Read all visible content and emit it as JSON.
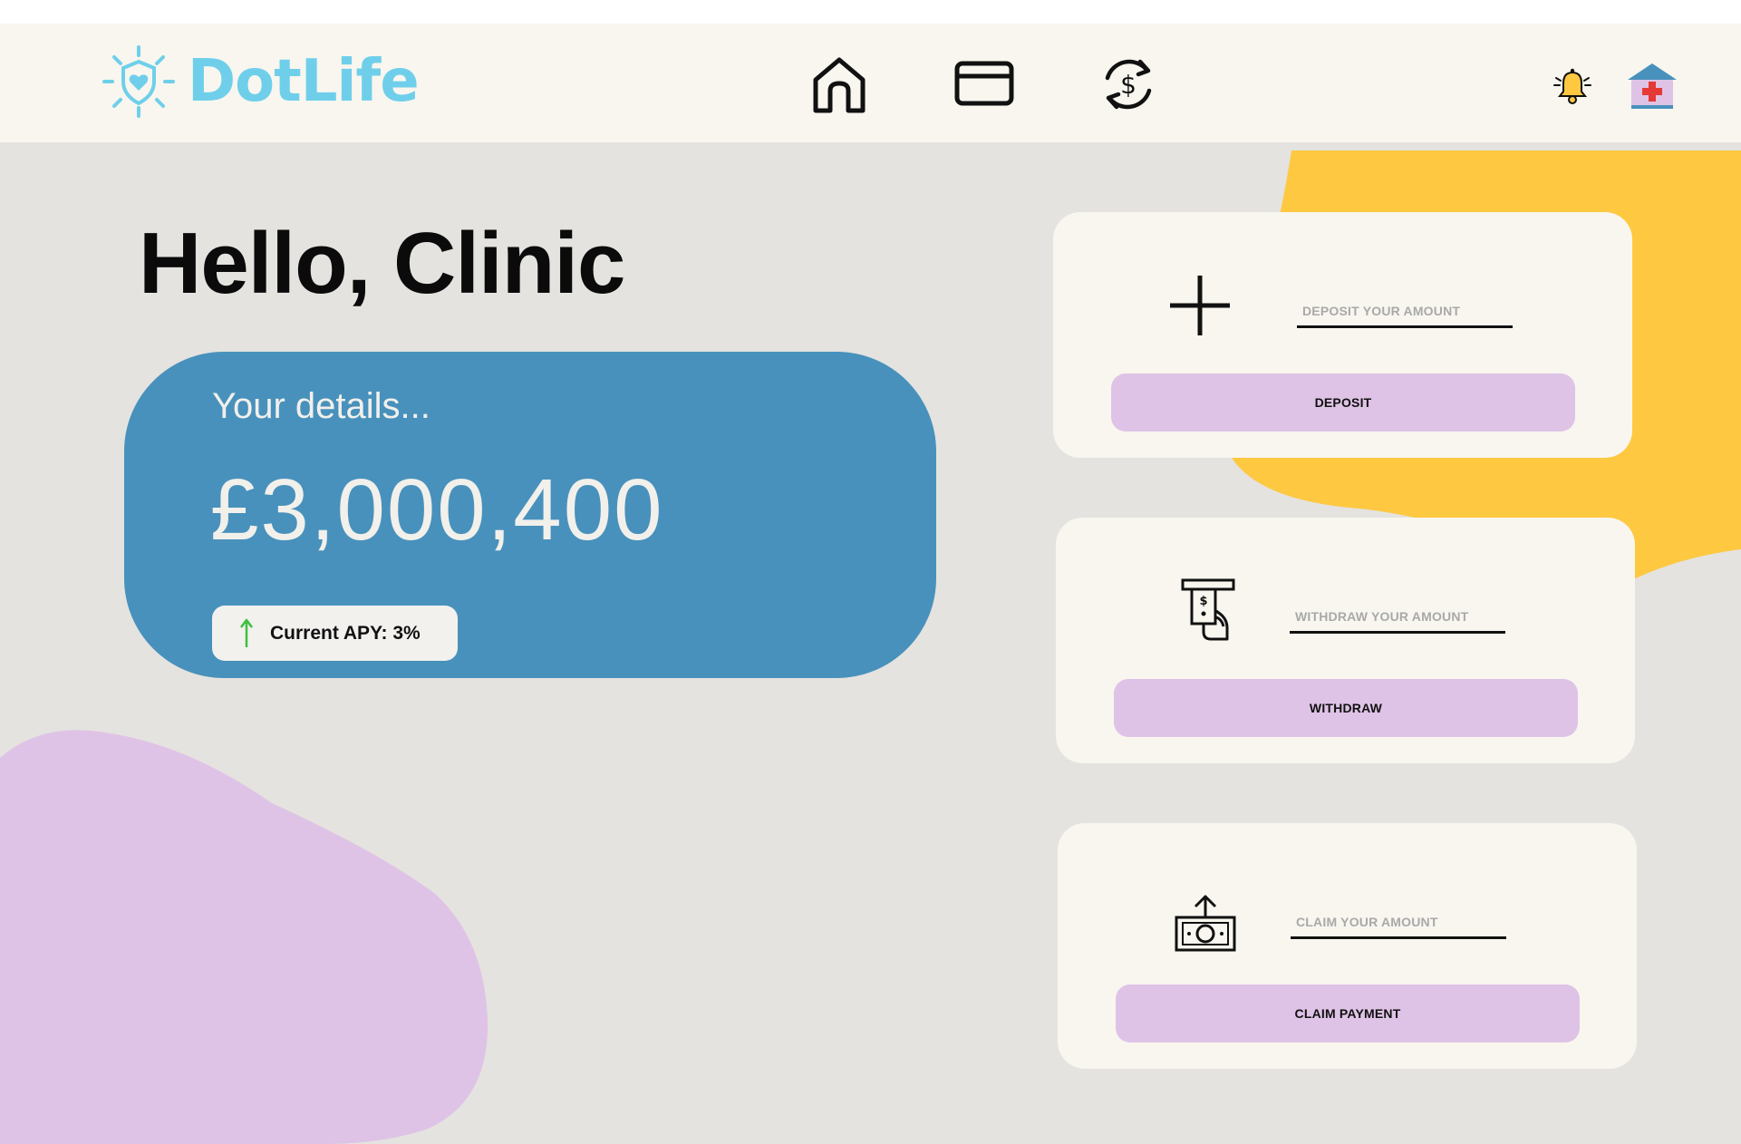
{
  "app": {
    "name": "DotLife",
    "brand_color": "#6fcfea"
  },
  "header": {
    "nav_icons": [
      "home-icon",
      "card-icon",
      "currency-exchange-icon"
    ],
    "right_icons": [
      "bell-icon",
      "hospital-icon"
    ]
  },
  "main": {
    "greeting": "Hello, Clinic"
  },
  "details": {
    "label": "Your details...",
    "balance": "£3,000,400",
    "apy_label": "Current APY: 3%",
    "card_color": "#4891bc"
  },
  "actions": {
    "deposit": {
      "icon": "plus-icon",
      "placeholder": "DEPOSIT YOUR AMOUNT",
      "button": "DEPOSIT"
    },
    "withdraw": {
      "icon": "atm-withdraw-icon",
      "placeholder": "WITHDRAW YOUR AMOUNT",
      "button": "WITHDRAW"
    },
    "claim": {
      "icon": "money-claim-icon",
      "placeholder": "CLAIM YOUR AMOUNT",
      "button": "CLAIM PAYMENT"
    }
  },
  "colors": {
    "background": "#e4e3df",
    "header": "#f8f6ef",
    "button": "#dfc3e6",
    "yellow_blob": "#fec841",
    "purple_blob": "#dfc3e6"
  }
}
